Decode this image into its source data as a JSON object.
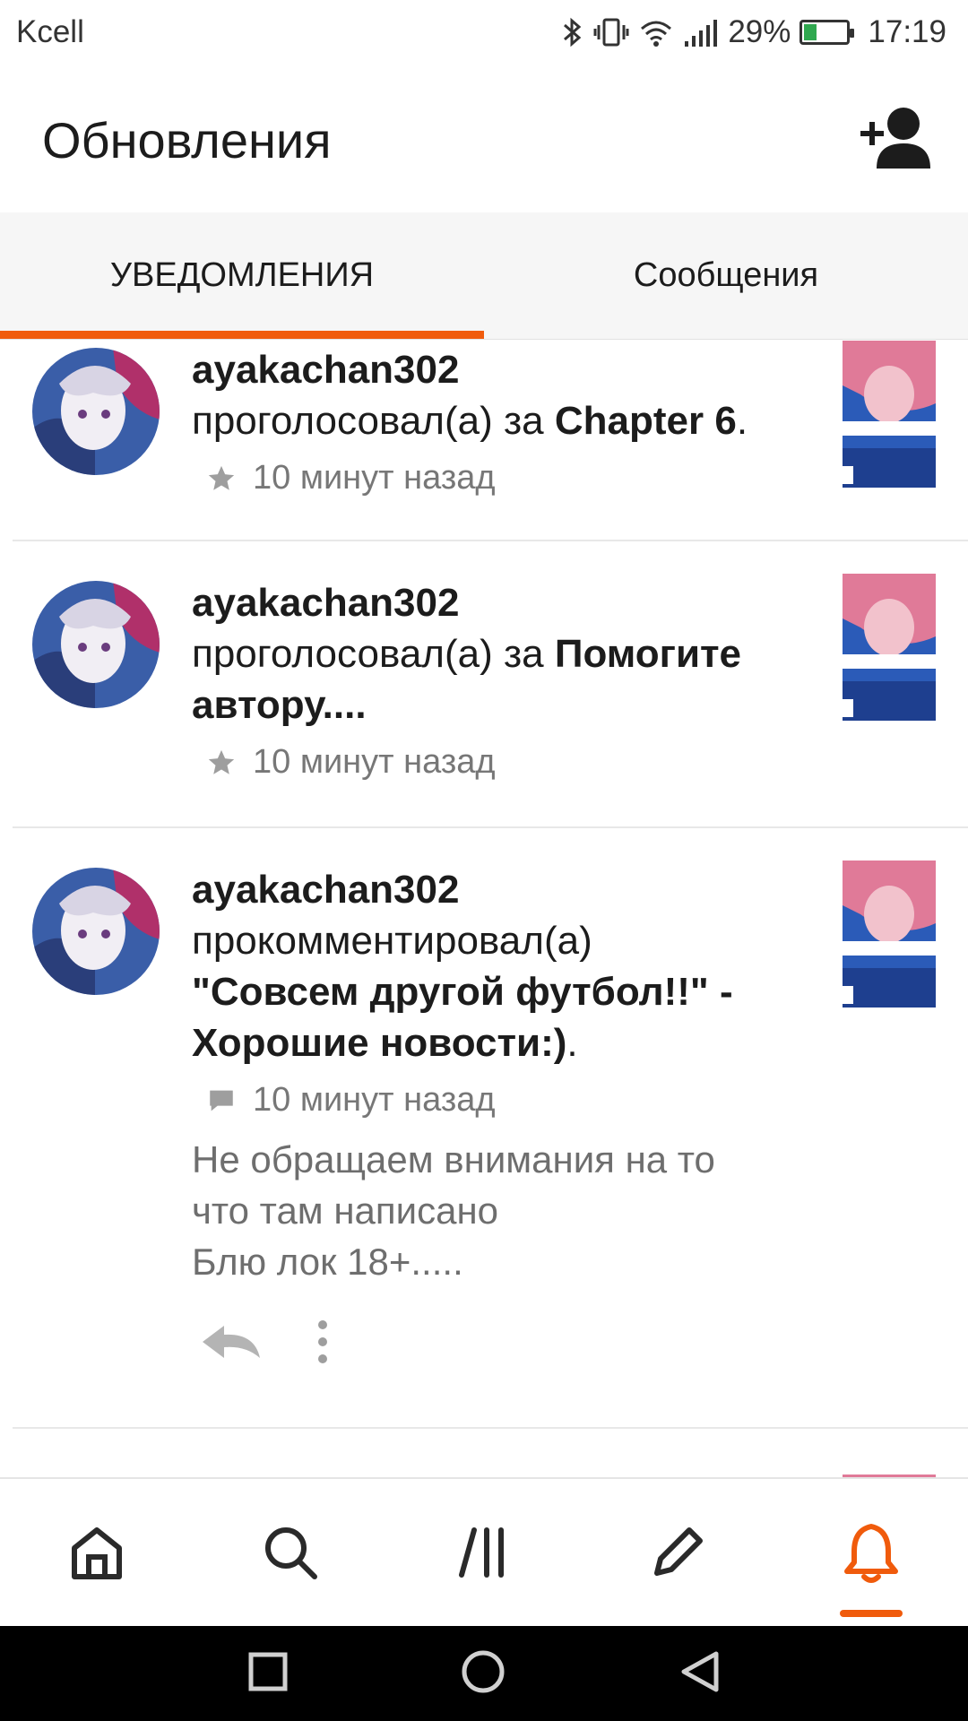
{
  "status": {
    "carrier": "Kcell",
    "battery": "29%",
    "time": "17:19"
  },
  "header": {
    "title": "Обновления"
  },
  "tabs": [
    {
      "label": "УВЕДОМЛЕНИЯ",
      "active": true
    },
    {
      "label": "Сообщения",
      "active": false
    }
  ],
  "notifications": [
    {
      "user": "ayakachan302",
      "action": "проголосовал(а) за ",
      "target": "Chapter 6",
      "suffix": ".",
      "icon": "star-icon",
      "time": "10 минут назад"
    },
    {
      "user": "ayakachan302",
      "action": "проголосовал(а) за ",
      "target_line1": "Помогите",
      "target_line2": "автору....",
      "icon": "star-icon",
      "time": "10 минут назад"
    },
    {
      "user": "ayakachan302",
      "action": "прокомментировал(а)",
      "target_line1": "\"Совсем другой футбол!!\" -",
      "target_line2": "Хорошие новости:)",
      "suffix": ".",
      "icon": "comment-icon",
      "time": "10 минут назад",
      "excerpt_lines": [
        "Не обращаем внимания на то",
        "что там написано",
        "Блю лок 18+....."
      ]
    }
  ],
  "bottom_nav": [
    {
      "icon": "home-icon",
      "active": false
    },
    {
      "icon": "search-icon",
      "active": false
    },
    {
      "icon": "library-icon",
      "active": false
    },
    {
      "icon": "pencil-icon",
      "active": false
    },
    {
      "icon": "bell-icon",
      "active": true
    }
  ],
  "colors": {
    "accent": "#f05b0c",
    "tab_background": "#f6f6f6",
    "secondary_text": "#777777"
  }
}
